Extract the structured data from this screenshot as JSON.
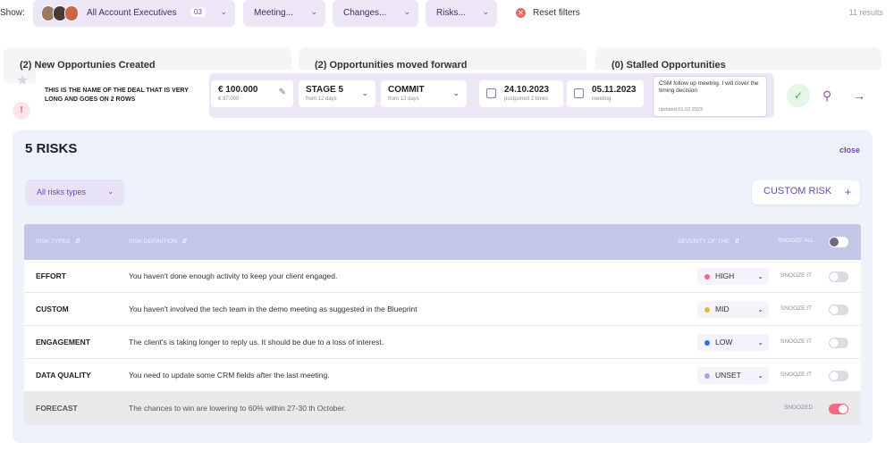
{
  "filters": {
    "show_label": "Show:",
    "account_execs_label": "All Account Executives",
    "account_execs_count": "03",
    "meeting_label": "Meeting...",
    "changes_label": "Changes...",
    "risks_label": "Risks...",
    "reset_label": "Reset filters",
    "results_text": "11 results"
  },
  "tabs": [
    {
      "label": "(2) New Opportunies Created"
    },
    {
      "label": "(2) Opportunities moved forward"
    },
    {
      "label": "(0) Stalled Opportunities"
    }
  ],
  "deal": {
    "title": "THIS IS THE NAME OF THE DEAL THAT IS VERY LONG AND GOES ON 2 ROWS",
    "amount": "€ 100.000",
    "amount_sub": "€ 37.000",
    "stage": "STAGE 5",
    "stage_sub": "from 12 days",
    "forecast": "COMMIT",
    "forecast_sub": "from 12 days",
    "close_date": "24.10.2023",
    "close_date_sub": "postponed 2 times",
    "meeting_date": "05.11.2023",
    "meeting_date_sub": "meeting",
    "note_text": "CSM follow up meeting. I will cover the timing decision",
    "note_updated": "updated 01.02.2023"
  },
  "risks_panel": {
    "title": "5 RISKS",
    "close_label": "close",
    "filter_label": "All risks types",
    "custom_risk_label": "CUSTOM RISK",
    "headers": {
      "type": "RISK TYPES",
      "definition": "RISK DEFINITION",
      "severity": "SEVERITY OF THE",
      "snooze_all": "SNOOZE ALL"
    },
    "rows": [
      {
        "type": "EFFORT",
        "definition": "You haven't done enough activity to keep your client engaged.",
        "severity": "HIGH",
        "severity_color": "#ef6a7e",
        "snooze": "SNOOZE IT",
        "snoozed": false
      },
      {
        "type": "CUSTOM",
        "definition": "You haven't involved the tech team in the demo meeting as suggested in the Blueprint",
        "severity": "MID",
        "severity_color": "#f2b63c",
        "snooze": "SNOOZE IT",
        "snoozed": false
      },
      {
        "type": "ENGAGEMENT",
        "definition": "The client's is taking longer to reply us. It should be due to a loss of interest.",
        "severity": "LOW",
        "severity_color": "#2f6fe0",
        "snooze": "SNOOZE IT",
        "snoozed": false
      },
      {
        "type": "DATA QUALITY",
        "definition": "You need to update some CRM fields after the last meeting.",
        "severity": "UNSET",
        "severity_color": "#a8a2e0",
        "snooze": "SNOOZE IT",
        "snoozed": false
      },
      {
        "type": "FORECAST",
        "definition": "The chances to win are lowering to 60% within 27-30 th October.",
        "severity": "",
        "severity_color": "",
        "snooze": "SNOOZED",
        "snoozed": true
      }
    ]
  }
}
